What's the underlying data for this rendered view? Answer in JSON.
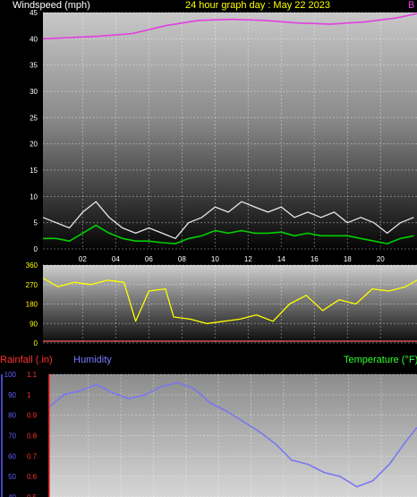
{
  "header": {
    "left_label": "Windspeed (mph)",
    "title": "24 hour graph day : May 22 2023",
    "right_label": "B"
  },
  "labels_row": {
    "rainfall": "Rainfall (.in)",
    "humidity": "Humidity",
    "temperature": "Temperature (°F)"
  },
  "colors": {
    "background": "#000000",
    "barometer": "#e040e0",
    "wind_gust": "#e8e8e8",
    "wind_avg": "#00d000",
    "wind_dir": "#ffff00",
    "humidity": "#7878f0",
    "rainfall_axis": "#ff3030",
    "humidity_axis": "#6060ff",
    "temperature_label": "#30ff30",
    "title": "#ffff00"
  },
  "chart_data": [
    {
      "type": "line",
      "title": "24 hour graph day : May 22 2023",
      "ylabel": "Windspeed (mph)",
      "ylim": [
        0,
        45
      ],
      "y_ticks": [
        0,
        5,
        10,
        15,
        20,
        25,
        30,
        35,
        40,
        45
      ],
      "x_ticks": [
        "02",
        "04",
        "06",
        "08",
        "10",
        "12",
        "14",
        "16",
        "18",
        "20"
      ],
      "x_tick_hours": [
        2,
        4,
        6,
        8,
        10,
        12,
        14,
        16,
        18,
        20
      ],
      "x_range_hours": [
        -0.4,
        22.2
      ],
      "grid": true,
      "series": [
        {
          "name": "B",
          "x": [
            -0.4,
            1,
            3,
            5,
            7,
            9,
            11,
            13,
            15,
            17,
            19,
            21,
            22.2
          ],
          "values": [
            40,
            40.2,
            40.5,
            41,
            42.5,
            43.5,
            43.7,
            43.5,
            43,
            42.8,
            43.2,
            44,
            44.8
          ]
        },
        {
          "x": [
            -0.4,
            0.4,
            1.2,
            2,
            2.8,
            3.6,
            4.4,
            5.2,
            6,
            6.8,
            7.6,
            8.4,
            9.2,
            10,
            10.8,
            11.6,
            12.4,
            13.2,
            14,
            14.8,
            15.6,
            16.4,
            17.2,
            18,
            18.8,
            19.6,
            20.4,
            21.2,
            22
          ],
          "values": [
            6,
            5,
            4,
            7,
            9,
            6,
            4,
            3,
            4,
            3,
            2,
            5,
            6,
            8,
            7,
            9,
            8,
            7,
            8,
            6,
            7,
            6,
            7,
            5,
            6,
            5,
            3,
            5,
            6
          ]
        },
        {
          "x": [
            -0.4,
            0.4,
            1.2,
            2,
            2.8,
            3.6,
            4.4,
            5.2,
            6,
            6.8,
            7.6,
            8.4,
            9.2,
            10,
            10.8,
            11.6,
            12.4,
            13.2,
            14,
            14.8,
            15.6,
            16.4,
            17.2,
            18,
            18.8,
            19.6,
            20.4,
            21.2,
            22
          ],
          "values": [
            2,
            2,
            1.5,
            3,
            4.5,
            3,
            2,
            1.5,
            1.5,
            1.2,
            1,
            2,
            2.5,
            3.5,
            3,
            3.5,
            3,
            3,
            3.2,
            2.5,
            3,
            2.5,
            2.5,
            2.5,
            2,
            1.5,
            1,
            2,
            2.5
          ]
        }
      ]
    },
    {
      "type": "line",
      "ylim": [
        0,
        360
      ],
      "y_ticks": [
        0,
        90,
        180,
        270,
        360
      ],
      "x_range_hours": [
        -0.4,
        22.2
      ],
      "grid": true,
      "series": [
        {
          "x": [
            -0.4,
            0.5,
            1.5,
            2.5,
            3.5,
            4.5,
            5.2,
            6,
            7,
            7.5,
            8.5,
            9.5,
            10.5,
            11.5,
            12.5,
            13.5,
            14.5,
            15.5,
            16.5,
            17.5,
            18.5,
            19.5,
            20.5,
            21.5,
            22.2
          ],
          "values": [
            300,
            260,
            280,
            270,
            290,
            280,
            100,
            240,
            250,
            120,
            110,
            90,
            100,
            110,
            130,
            100,
            180,
            220,
            150,
            200,
            180,
            250,
            240,
            260,
            290
          ]
        }
      ]
    },
    {
      "type": "line",
      "ylim": [
        40,
        100
      ],
      "y_ticks": [
        40,
        50,
        60,
        70,
        80,
        90,
        100
      ],
      "y2_ticks": [
        "0.5",
        "0.6",
        "0.7",
        "0.8",
        "0.9",
        "1",
        "1.1"
      ],
      "x_range_hours": [
        -0.4,
        22.2
      ],
      "grid": true,
      "series": [
        {
          "name": "Humidity",
          "x": [
            -0.4,
            0.5,
            1.5,
            2.5,
            3.5,
            4.5,
            5.5,
            6.5,
            7.5,
            8.5,
            9.5,
            10.5,
            11.5,
            12.5,
            13.5,
            14.5,
            15.5,
            16.5,
            17.5,
            18.5,
            19.5,
            20.5,
            21.5,
            22.2
          ],
          "values": [
            84,
            90,
            92,
            95,
            91,
            88,
            90,
            94,
            96,
            93,
            86,
            82,
            77,
            72,
            66,
            58,
            56,
            52,
            50,
            45,
            48,
            56,
            67,
            74
          ]
        }
      ]
    }
  ]
}
